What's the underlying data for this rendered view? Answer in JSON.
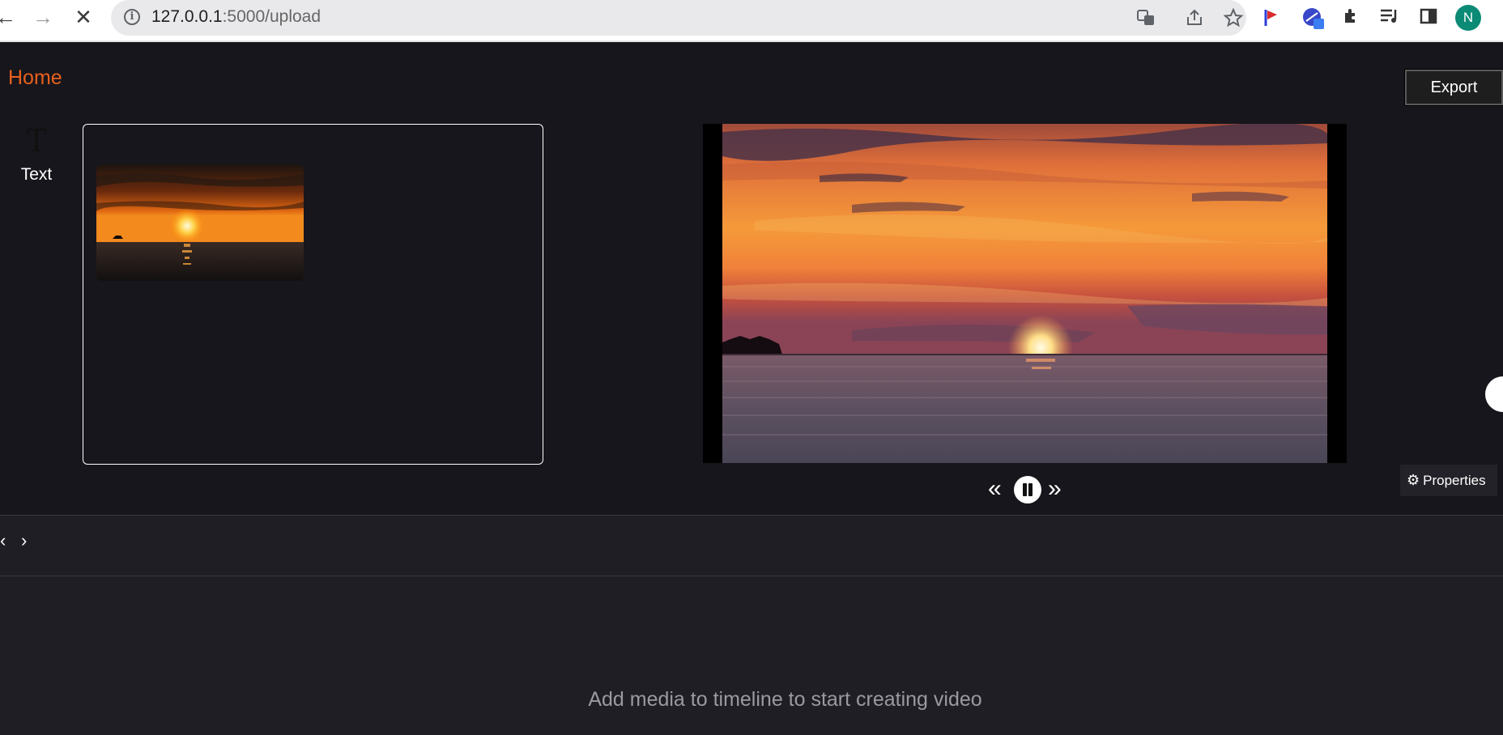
{
  "browser": {
    "url_host": "127.0.0.1",
    "url_path": ":5000/upload",
    "profile_initial": "N"
  },
  "app": {
    "home_label": "Home",
    "export_label": "Export",
    "tools": [
      {
        "label": "Text",
        "icon": "T"
      }
    ],
    "properties_label": "Properties",
    "timeline_empty_message": "Add media to timeline to start creating video"
  },
  "icons": {
    "back": "←",
    "forward": "→",
    "stop": "✕",
    "prev": "«",
    "next": "»",
    "gear": "⚙",
    "timeline_prev": "‹",
    "timeline_next": "›"
  },
  "colors": {
    "accent": "#e8601d",
    "background": "#17161c",
    "timeline_bg": "#1f1e24"
  }
}
